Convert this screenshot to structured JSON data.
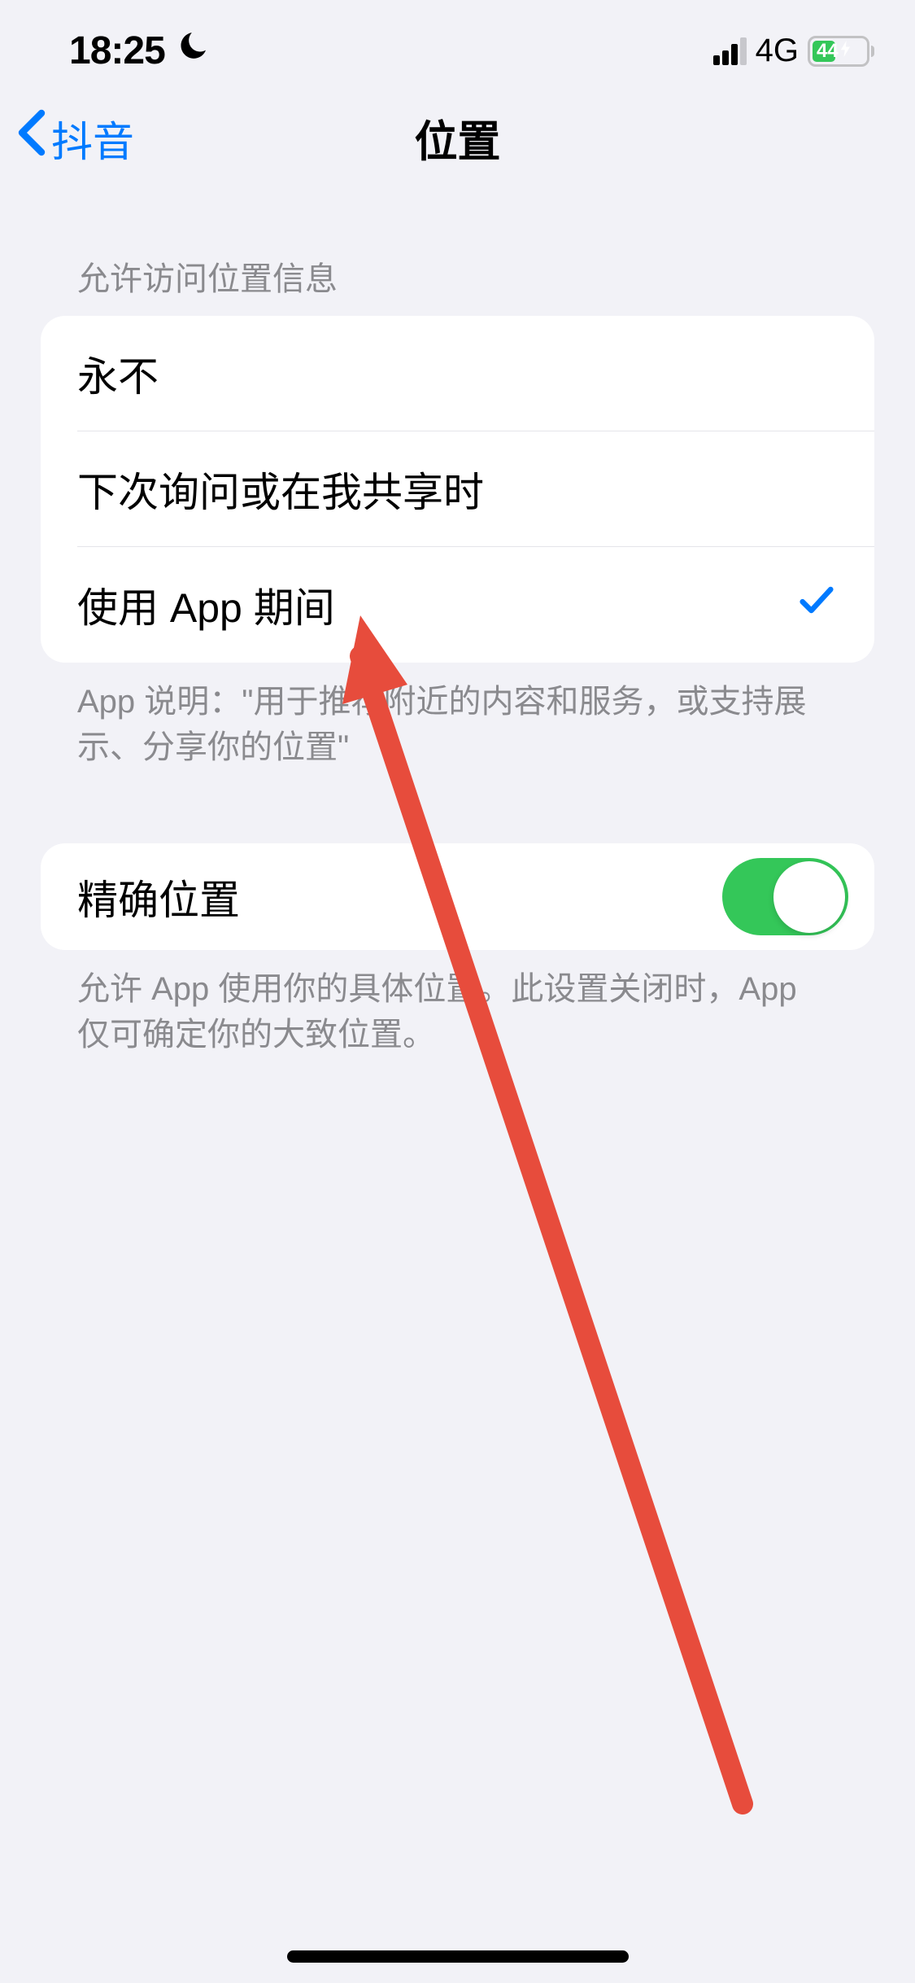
{
  "statusBar": {
    "time": "18:25",
    "network": "4G",
    "battery": "44"
  },
  "nav": {
    "backLabel": "抖音",
    "title": "位置"
  },
  "section1": {
    "header": "允许访问位置信息",
    "options": [
      {
        "label": "永不",
        "selected": false
      },
      {
        "label": "下次询问或在我共享时",
        "selected": false
      },
      {
        "label": "使用 App 期间",
        "selected": true
      }
    ],
    "footer": "App 说明：\"用于推荐附近的内容和服务，或支持展示、分享你的位置\""
  },
  "section2": {
    "row": {
      "label": "精确位置",
      "on": true
    },
    "footer": "允许 App 使用你的具体位置。此设置关闭时，App 仅可确定你的大致位置。"
  }
}
